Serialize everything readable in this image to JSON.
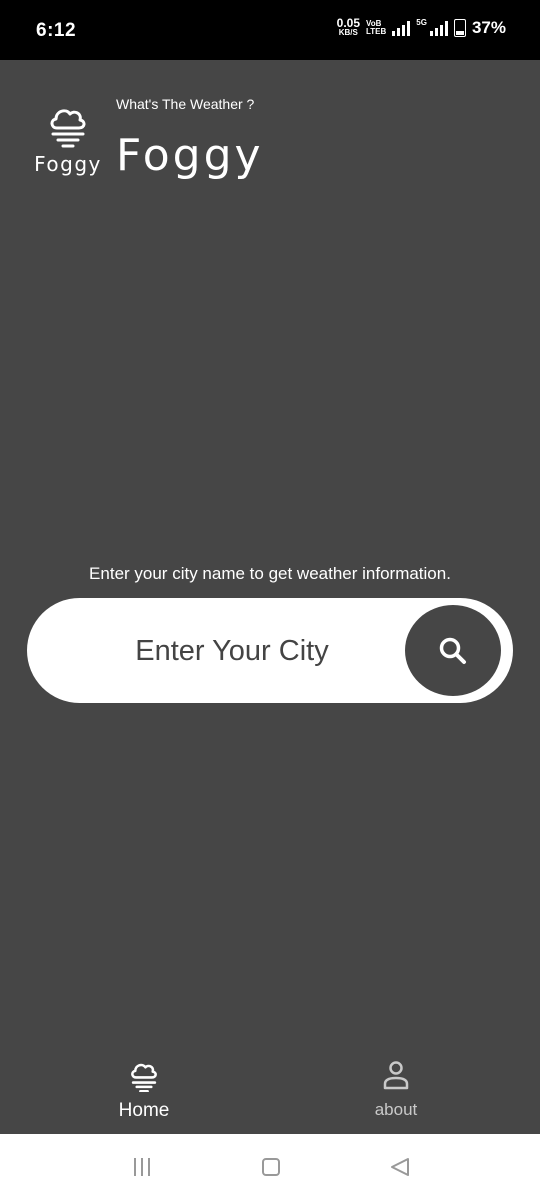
{
  "status_bar": {
    "time": "6:12",
    "net_speed_value": "0.05",
    "net_speed_unit": "KB/S",
    "volte_top": "VoB",
    "volte_bottom": "LTEB",
    "network_type": "5G",
    "battery": "37%"
  },
  "header": {
    "subtitle": "What's The Weather ?",
    "title": "Foggy",
    "logo_text": "Foggy",
    "logo_icon": "foggy-cloud-icon"
  },
  "main": {
    "prompt": "Enter your city name to get weather information.",
    "search_placeholder": "Enter Your City",
    "search_icon": "search-icon"
  },
  "bottom_nav": {
    "items": [
      {
        "label": "Home",
        "icon": "foggy-cloud-icon",
        "active": true
      },
      {
        "label": "about",
        "icon": "person-icon",
        "active": false
      }
    ]
  },
  "system_nav": {
    "recents_icon": "recents-icon",
    "home_icon": "home-square-icon",
    "back_icon": "back-triangle-icon"
  },
  "colors": {
    "background": "#464646",
    "status_bar": "#000000",
    "search_bar": "#ffffff",
    "search_button": "#464646"
  }
}
